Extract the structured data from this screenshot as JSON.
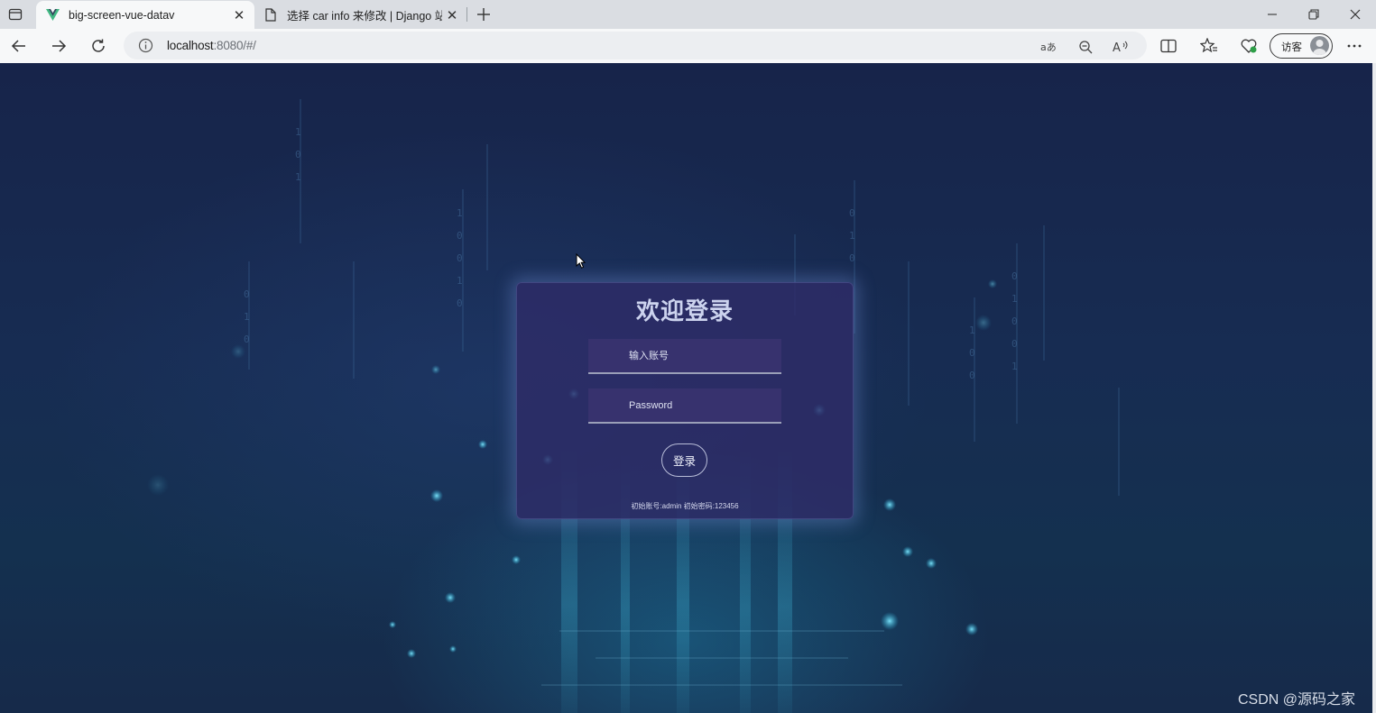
{
  "browser": {
    "tabs": [
      {
        "title": "big-screen-vue-datav",
        "active": true,
        "favicon": "vue-logo-icon"
      },
      {
        "title": "选择 car info 来修改 | Django 站点管理",
        "active": false,
        "favicon": "page-icon"
      }
    ],
    "address": {
      "host": "localhost",
      "rest": ":8080/#/"
    },
    "profile_label": "访客"
  },
  "login": {
    "title": "欢迎登录",
    "username_placeholder": "输入账号",
    "password_placeholder": "Password",
    "submit_label": "登录",
    "hint": "初始账号:admin 初始密码:123456"
  },
  "watermark": "CSDN @源码之家",
  "colors": {
    "page_background": "#172c52",
    "card_background": "#2e2c68",
    "title_text": "#ccd3ee"
  }
}
